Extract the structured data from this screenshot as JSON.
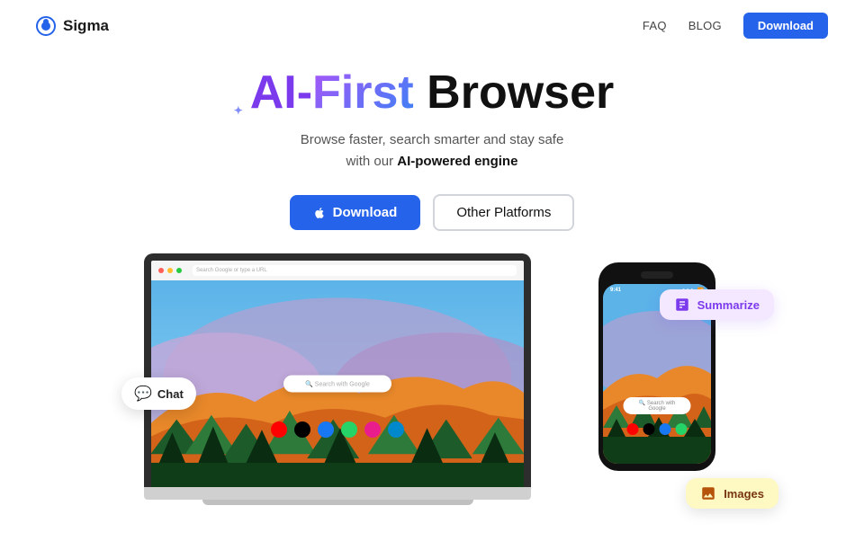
{
  "nav": {
    "logo_text": "Sigma",
    "links": [
      {
        "label": "FAQ",
        "id": "faq"
      },
      {
        "label": "BLOG",
        "id": "blog"
      }
    ],
    "download_btn": "Download"
  },
  "hero": {
    "title_part1": "AI-",
    "title_part2": "First",
    "title_part3": " Browser",
    "subtitle_line1": "Browse faster, search smarter and stay safe",
    "subtitle_line2": "with our ",
    "subtitle_bold": "AI-powered engine",
    "btn_download": "Download",
    "btn_platforms": "Other Platforms"
  },
  "badges": {
    "chat": "Chat",
    "summarize": "Summarize",
    "images": "Images"
  },
  "browser": {
    "address_placeholder": "Search Google or type a URL"
  }
}
